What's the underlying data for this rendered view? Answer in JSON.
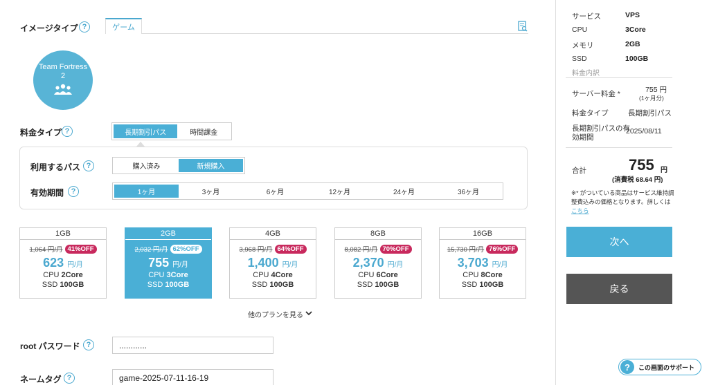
{
  "image_type": {
    "label": "イメージタイプ",
    "help": "?",
    "tab": "ゲーム",
    "doc_icon": "document-search-icon"
  },
  "game": {
    "name_line1": "Team Fortress",
    "name_line2": "2"
  },
  "price_type": {
    "label": "料金タイプ",
    "help": "?",
    "options": [
      "長期割引パス",
      "時間課金"
    ],
    "selected": 0
  },
  "pass": {
    "label": "利用するパス",
    "help": "?",
    "options": [
      "購入済み",
      "新規購入"
    ],
    "selected": 1
  },
  "period": {
    "label": "有効期間",
    "help": "?",
    "options": [
      "1ヶ月",
      "3ヶ月",
      "6ヶ月",
      "12ヶ月",
      "24ヶ月",
      "36ヶ月"
    ],
    "selected": 0
  },
  "plans": [
    {
      "mem": "1GB",
      "old": "1,064 円/月",
      "off": "41%OFF",
      "price": "623",
      "unit": "円/月",
      "cpu_label": "CPU",
      "cpu": "2Core",
      "ssd_label": "SSD",
      "ssd": "100GB"
    },
    {
      "mem": "2GB",
      "old": "2,032 円/月",
      "off": "62%OFF",
      "price": "755",
      "unit": "円/月",
      "cpu_label": "CPU",
      "cpu": "3Core",
      "ssd_label": "SSD",
      "ssd": "100GB"
    },
    {
      "mem": "4GB",
      "old": "3,968 円/月",
      "off": "64%OFF",
      "price": "1,400",
      "unit": "円/月",
      "cpu_label": "CPU",
      "cpu": "4Core",
      "ssd_label": "SSD",
      "ssd": "100GB"
    },
    {
      "mem": "8GB",
      "old": "8,082 円/月",
      "off": "70%OFF",
      "price": "2,370",
      "unit": "円/月",
      "cpu_label": "CPU",
      "cpu": "6Core",
      "ssd_label": "SSD",
      "ssd": "100GB"
    },
    {
      "mem": "16GB",
      "old": "15,730 円/月",
      "off": "76%OFF",
      "price": "3,703",
      "unit": "円/月",
      "cpu_label": "CPU",
      "cpu": "8Core",
      "ssd_label": "SSD",
      "ssd": "100GB"
    }
  ],
  "selected_plan": 1,
  "more_plans": "他のプランを見る",
  "root_password": {
    "label": "root パスワード",
    "help": "?",
    "value": "............"
  },
  "name_tag": {
    "label": "ネームタグ",
    "help": "?",
    "value": "game-2025-07-11-16-19"
  },
  "summary": {
    "service_label": "サービス",
    "service": "VPS",
    "cpu_label": "CPU",
    "cpu": "3Core",
    "memory_label": "メモリ",
    "memory": "2GB",
    "ssd_label": "SSD",
    "ssd": "100GB",
    "breakdown": "料金内訳",
    "server_fee_label": "サーバー料金 *",
    "server_fee": "755 円",
    "server_fee_note": "(1ヶ月分)",
    "price_type_label": "料金タイプ",
    "price_type": "長期割引パス",
    "pass_expiry_label1": "長期割引パスの有",
    "pass_expiry_label2": "効期間",
    "pass_expiry": "2025/08/11",
    "total_label": "合計",
    "total": "755",
    "total_unit": "円",
    "tax": "(消費税 68.64 円)",
    "note_line1": "※* がついている商品はサービス維持調",
    "note_line2": "整費込みの価格となります。詳しくは",
    "note_link": "こちら",
    "next": "次へ",
    "back": "戻る"
  },
  "support": {
    "label": "この画面のサポート",
    "icon": "?"
  },
  "colors": {
    "accent": "#4aafd6",
    "badge": "#c8295d",
    "back": "#555555"
  }
}
